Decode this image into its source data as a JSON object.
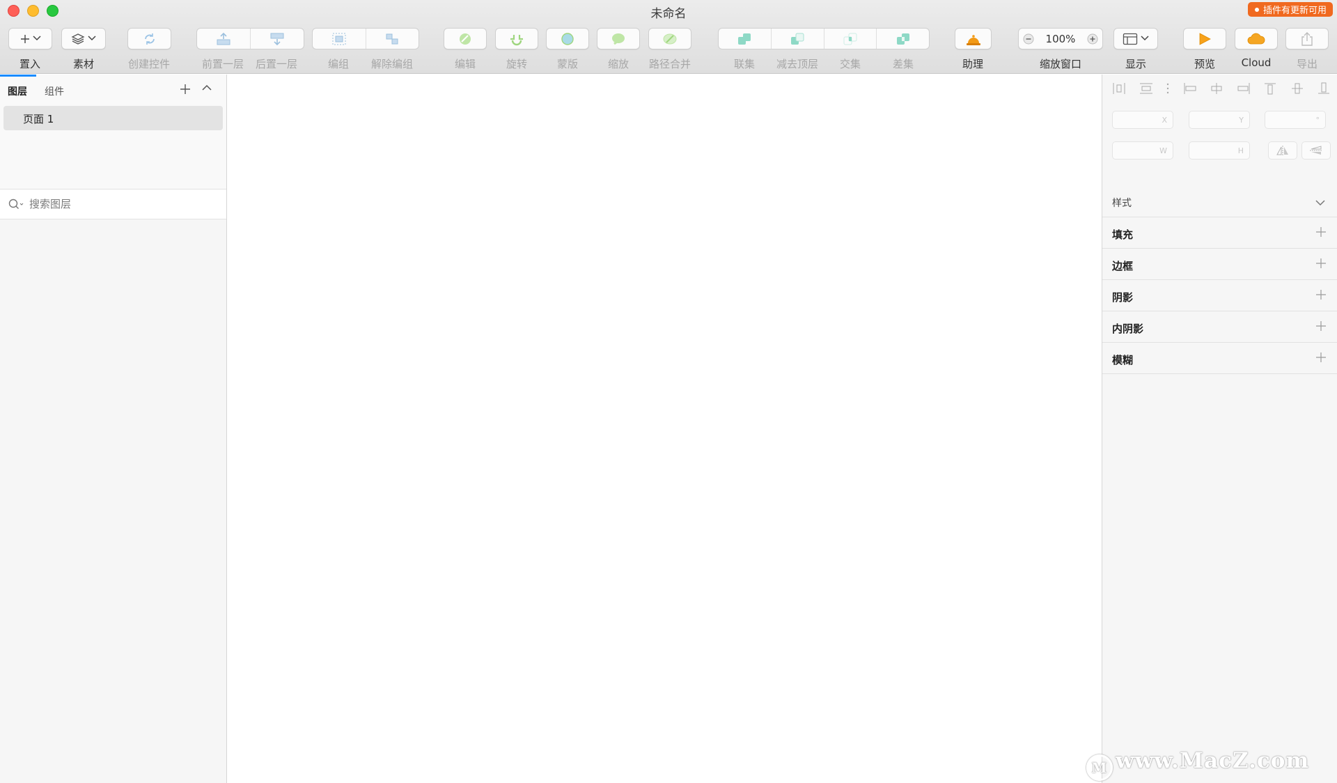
{
  "window": {
    "title": "未命名",
    "update_badge": "插件有更新可用"
  },
  "toolbar": {
    "insert": "置入",
    "assets": "素材",
    "create_symbol": "创建控件",
    "forward": "前置一层",
    "backward": "后置一层",
    "group": "编组",
    "ungroup": "解除编组",
    "edit": "编辑",
    "rotate": "旋转",
    "mask": "蒙版",
    "scale": "缩放",
    "flatten": "路径合并",
    "union": "联集",
    "subtract": "减去顶层",
    "intersect": "交集",
    "difference": "差集",
    "assistant": "助理",
    "zoom_label": "缩放窗口",
    "zoom_value": "100%",
    "view": "显示",
    "preview": "预览",
    "cloud": "Cloud",
    "export": "导出"
  },
  "sidebar": {
    "tabs": [
      "图层",
      "组件"
    ],
    "pages": [
      {
        "label": "页面 1"
      }
    ],
    "search_placeholder": "搜索图层"
  },
  "inspector": {
    "fields": {
      "x": "X",
      "y": "Y",
      "rot": "°",
      "w": "W",
      "h": "H"
    },
    "style_title": "样式",
    "sections": [
      "填充",
      "边框",
      "阴影",
      "内阴影",
      "模糊"
    ]
  },
  "watermark": "www.MacZ.com",
  "colors": {
    "accent": "#1a8cff",
    "badge": "#f0691f",
    "boolean_icon": "#3fc4a8",
    "edit_icon": "#8fd16a",
    "assistant_icon": "#f29a16",
    "preview_icon": "#f7a21b",
    "cloud_icon": "#f5a623"
  }
}
